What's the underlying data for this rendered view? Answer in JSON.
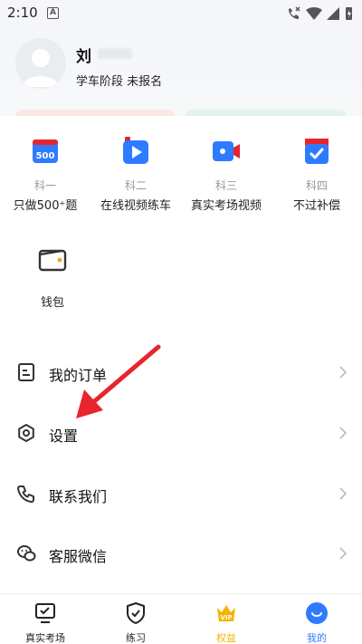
{
  "status_bar": {
    "time": "2:10",
    "notif_letter": "A"
  },
  "profile": {
    "name": "刘",
    "status": "学车阶段 未报名"
  },
  "grid": [
    {
      "sub": "科一",
      "label": "只做500⁺题",
      "icon": "book-500-icon",
      "icon_text": "500"
    },
    {
      "sub": "科二",
      "label": "在线视频练车",
      "icon": "play-video-icon"
    },
    {
      "sub": "科三",
      "label": "真实考场视频",
      "icon": "camera-video-icon"
    },
    {
      "sub": "科四",
      "label": "不过补偿",
      "icon": "shield-check-icon"
    }
  ],
  "wallet": {
    "label": "钱包",
    "icon": "wallet-icon"
  },
  "menu": [
    {
      "label": "我的订单",
      "icon": "order-icon"
    },
    {
      "label": "设置",
      "icon": "gear-icon"
    },
    {
      "label": "联系我们",
      "icon": "phone-icon"
    },
    {
      "label": "客服微信",
      "icon": "wechat-icon"
    }
  ],
  "nav": [
    {
      "label": "真实考场",
      "icon": "monitor-check-icon"
    },
    {
      "label": "练习",
      "icon": "shield-check-icon"
    },
    {
      "label": "权益",
      "icon": "vip-crown-icon",
      "badge": "VIP"
    },
    {
      "label": "我的",
      "icon": "smile-icon"
    }
  ],
  "colors": {
    "accent_blue": "#2f7bff",
    "vip_gold": "#f5b400",
    "red": "#e8242c",
    "nav_active": "#2f7bff"
  }
}
